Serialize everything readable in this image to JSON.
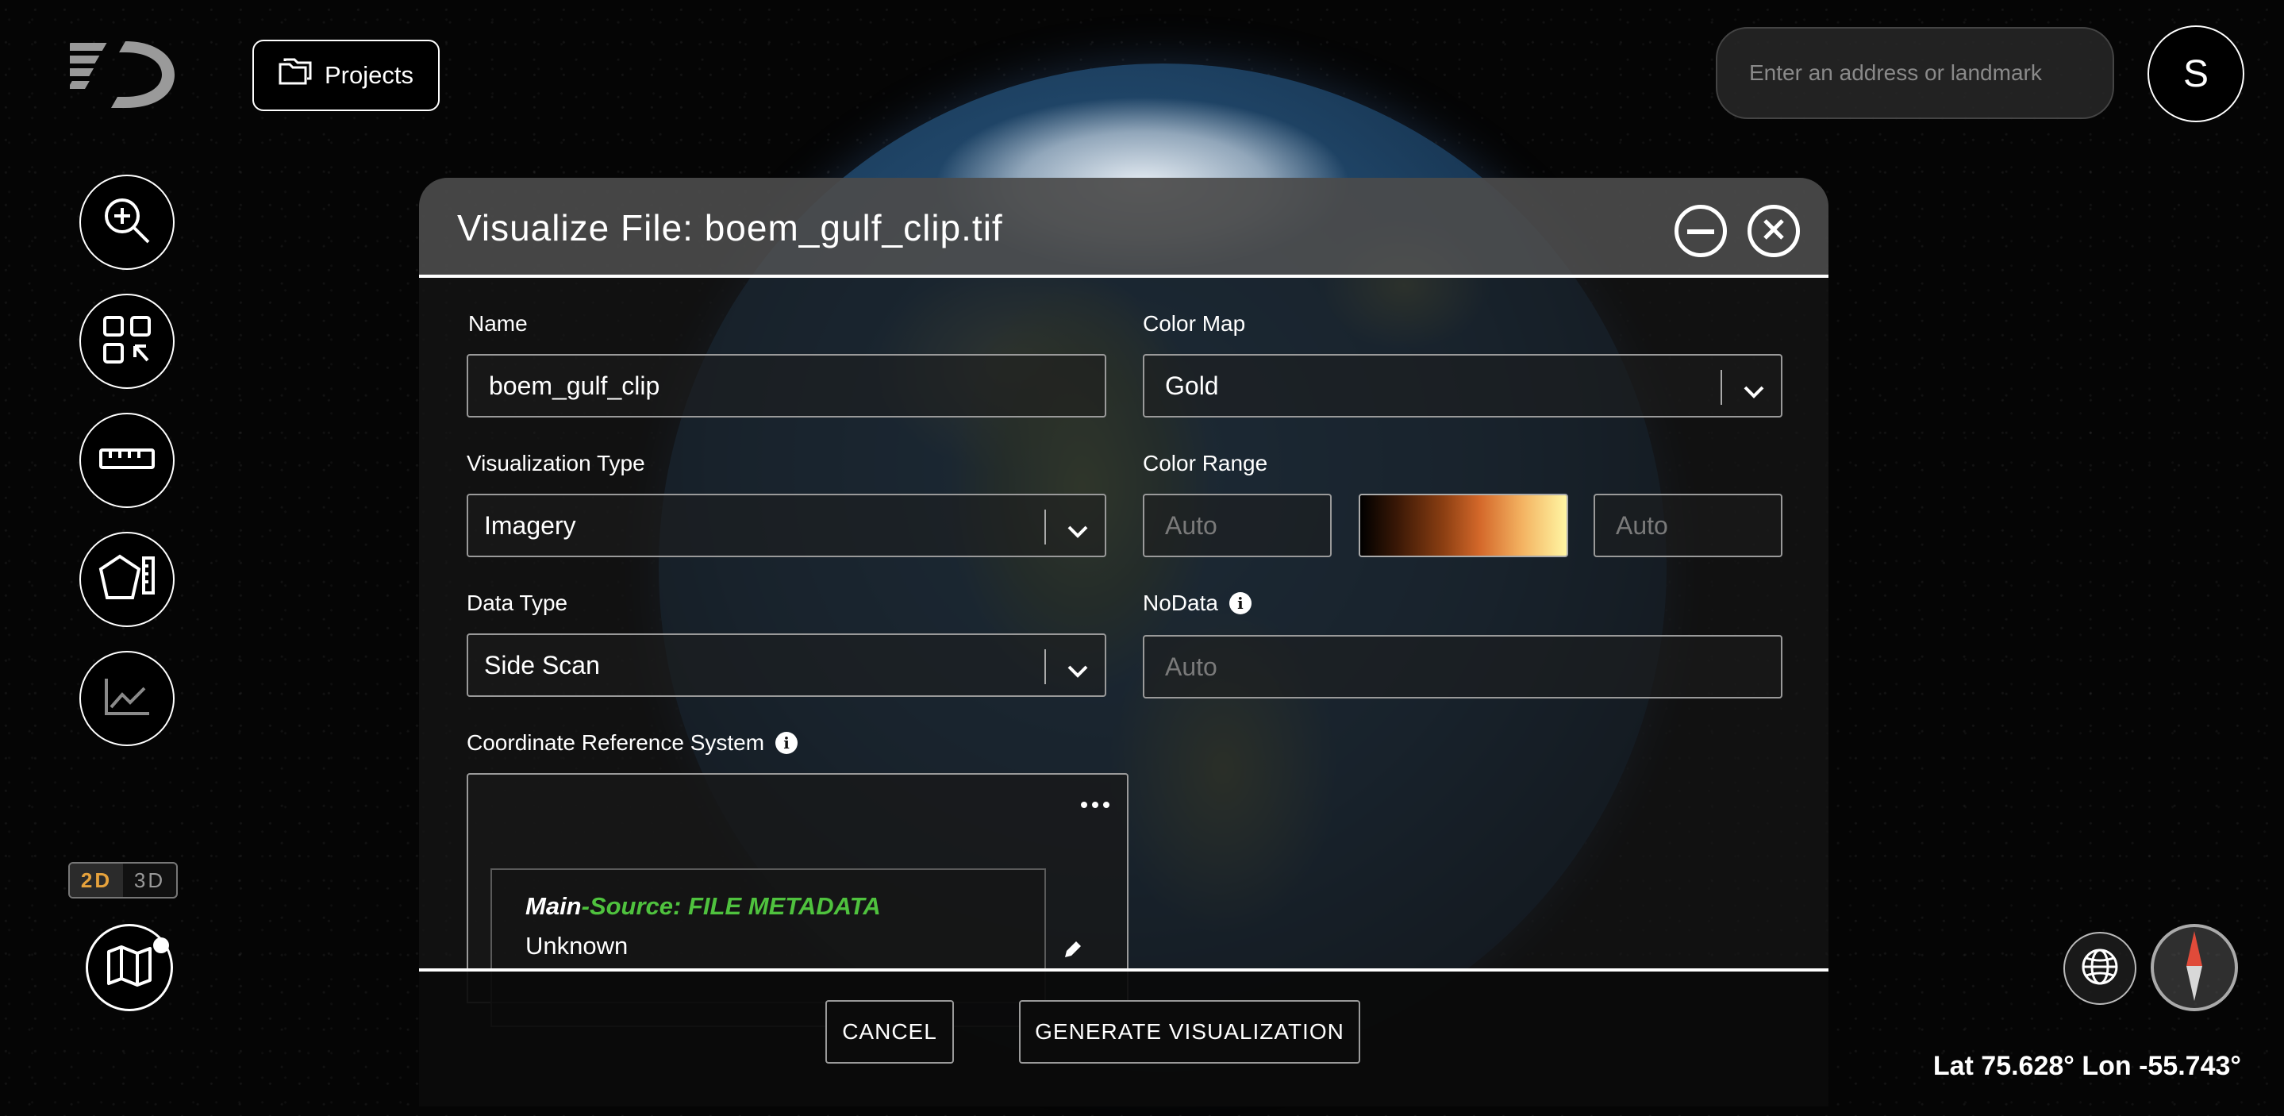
{
  "projects": {
    "label": "Projects"
  },
  "search": {
    "placeholder": "Enter an address or landmark"
  },
  "user": {
    "initial": "S"
  },
  "view_toggle": {
    "two_d": "2D",
    "three_d": "3D",
    "active": "2D"
  },
  "coordinates": {
    "text": "Lat 75.628° Lon -55.743°"
  },
  "colors": {
    "accent_2d": "#e6a23c",
    "crs_source": "#4fc23e",
    "gradient": [
      "#000000",
      "#8a3e12",
      "#d4682a",
      "#f3b160",
      "#fff6a3"
    ]
  },
  "icons": {
    "logo": "logo-icon",
    "projects": "folder-icon",
    "tools": [
      "zoom-in-icon",
      "grid-select-icon",
      "ruler-icon",
      "polygon-measure-icon",
      "chart-icon"
    ],
    "map": "map-icon",
    "globe": "globe-icon",
    "compass": "compass-icon"
  },
  "dialog": {
    "title": "Visualize File: boem_gulf_clip.tif",
    "name": {
      "label": "Name",
      "value": "boem_gulf_clip"
    },
    "visualization_type": {
      "label": "Visualization Type",
      "value": "Imagery"
    },
    "data_type": {
      "label": "Data Type",
      "value": "Side Scan"
    },
    "color_map": {
      "label": "Color Map",
      "value": "Gold"
    },
    "color_range": {
      "label": "Color Range",
      "min_placeholder": "Auto",
      "max_placeholder": "Auto"
    },
    "nodata": {
      "label": "NoData",
      "placeholder": "Auto"
    },
    "crs": {
      "label": "Coordinate Reference System",
      "main": "Main",
      "source": "-Source: FILE METADATA",
      "value": "Unknown"
    },
    "cancel_label": "CANCEL",
    "generate_label": "GENERATE VISUALIZATION"
  }
}
